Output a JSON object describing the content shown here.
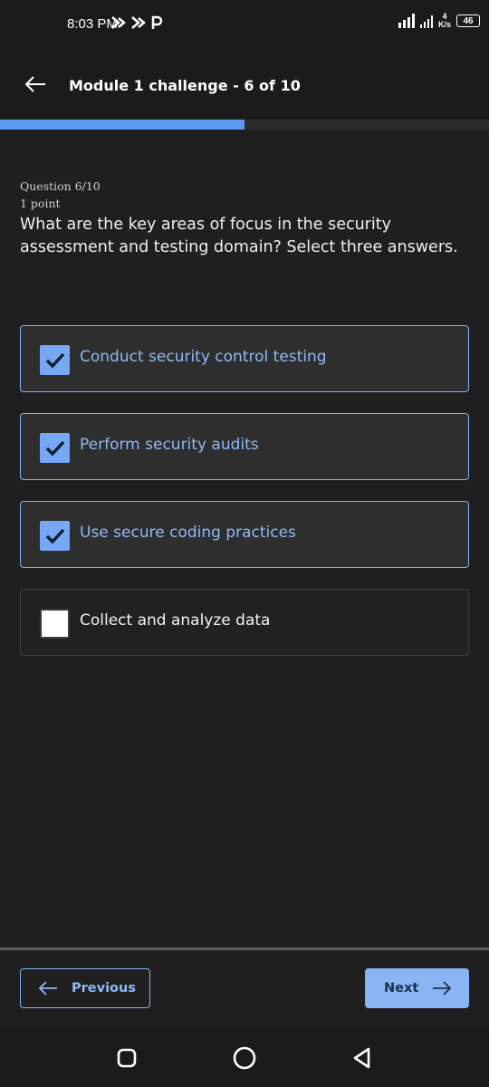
{
  "status_bar": {
    "time": "8:03 PM",
    "net_speed_value": "4",
    "net_speed_unit": "K/s",
    "battery": "46"
  },
  "header": {
    "title": "Module 1 challenge - 6 of 10"
  },
  "progress": {
    "fraction": 0.5
  },
  "question": {
    "counter": "Question 6/10",
    "points": "1 point",
    "text": "What are the key areas of focus in the security assessment and testing domain? Select three answers."
  },
  "options": [
    {
      "label": "Conduct security control testing",
      "checked": true
    },
    {
      "label": "Perform security audits",
      "checked": true
    },
    {
      "label": "Use secure coding practices",
      "checked": true
    },
    {
      "label": "Collect and analyze data",
      "checked": false
    }
  ],
  "footer": {
    "previous_label": "Previous",
    "next_label": "Next"
  },
  "colors": {
    "accent": "#8ab5f5",
    "background": "#1f1f1f"
  }
}
